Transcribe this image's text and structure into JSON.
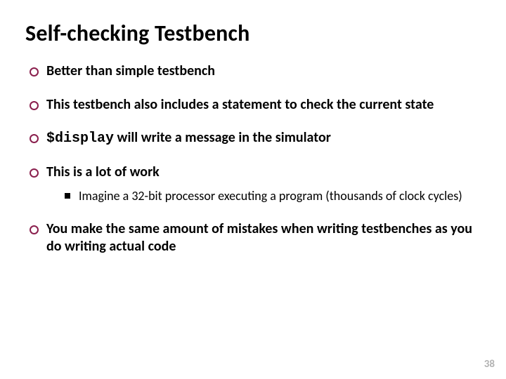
{
  "title": "Self-checking Testbench",
  "bullets": [
    {
      "text": "Better than simple testbench"
    },
    {
      "text": "This testbench also includes a statement to check the current state"
    },
    {
      "code": "$display",
      "text_after": " will write a message in the simulator"
    },
    {
      "text": "This is a lot of work",
      "sub": [
        "Imagine a 32-bit processor executing a program (thousands of clock cycles)"
      ]
    },
    {
      "text": "You make the same amount of mistakes when writing testbenches as you do writing actual code"
    }
  ],
  "page_number": "38"
}
